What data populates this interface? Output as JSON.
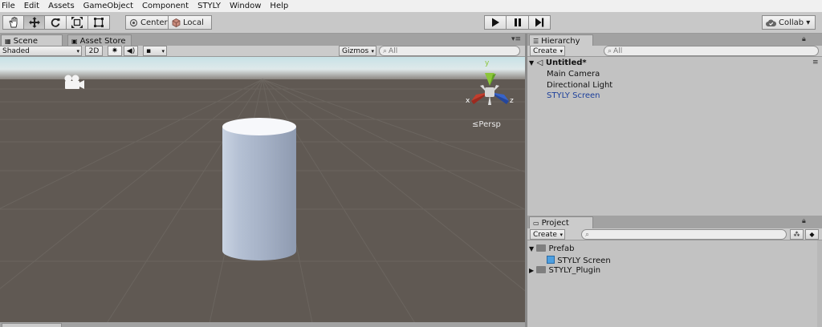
{
  "menu": [
    "File",
    "Edit",
    "Assets",
    "GameObject",
    "Component",
    "STYLY",
    "Window",
    "Help"
  ],
  "toolbar": {
    "tools": [
      "hand-icon",
      "move-icon",
      "rotate-icon",
      "scale-icon",
      "rect-tool-icon"
    ],
    "pivot_label": "Center",
    "space_label": "Local",
    "collab_label": "Collab ▾"
  },
  "scene_panel": {
    "tabs": [
      "Scene",
      "Asset Store"
    ],
    "shading_mode": "Shaded",
    "mode_2d": "2D",
    "gizmos_label": "Gizmos",
    "search_placeholder": "All",
    "persp_label": "Persp",
    "axis_labels": {
      "x": "x",
      "y": "y",
      "z": "z"
    }
  },
  "hierarchy": {
    "tab": "Hierarchy",
    "create_label": "Create",
    "search_placeholder": "All",
    "scene_name": "Untitled*",
    "items": [
      "Main Camera",
      "Directional Light",
      "STYLY Screen"
    ]
  },
  "project": {
    "tab": "Project",
    "create_label": "Create",
    "tree": [
      {
        "label": "Prefab",
        "type": "folder",
        "expanded": true
      },
      {
        "label": "STYLY Screen",
        "type": "prefab"
      },
      {
        "label": "STYLY_Plugin",
        "type": "folder",
        "expanded": false
      }
    ]
  }
}
